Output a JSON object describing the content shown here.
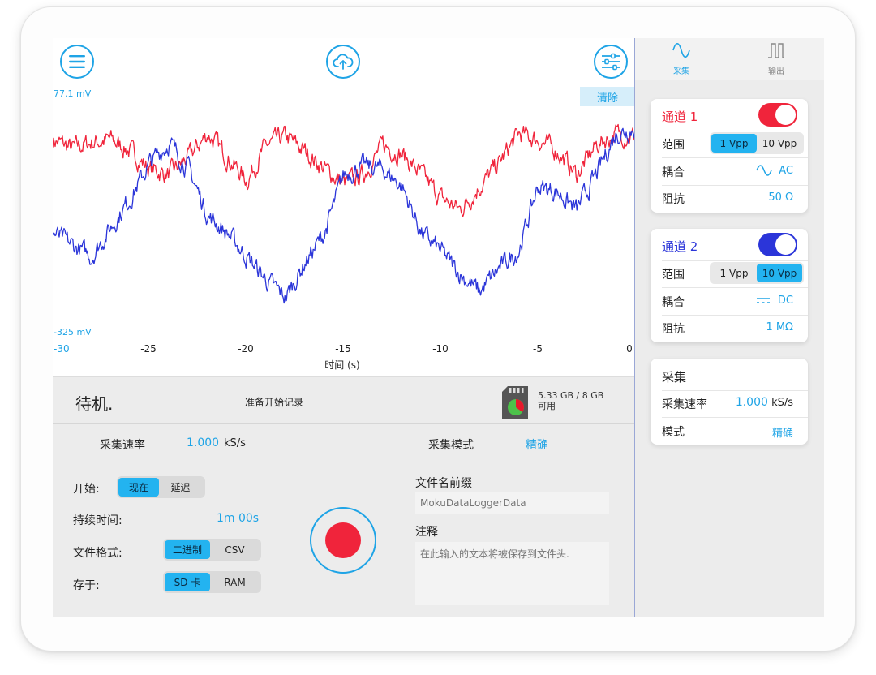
{
  "toolbar": {
    "menu_icon": "hamburger-icon",
    "upload_icon": "cloud-upload-icon",
    "settings_icon": "sliders-icon",
    "clear_label": "清除"
  },
  "plot": {
    "y_max_label": "77.1 mV",
    "y_min_label": "-325 mV",
    "x_label": "时间 (s)",
    "x_ticks": [
      "-30",
      "-25",
      "-20",
      "-15",
      "-10",
      "-5",
      "0"
    ]
  },
  "chart_data": {
    "type": "line",
    "xlabel": "时间 (s)",
    "xlim": [
      -30,
      0
    ],
    "ylim": [
      -325,
      77.1
    ],
    "y_unit": "mV",
    "grid": false,
    "series": [
      {
        "color": "#f0243b",
        "x": [
          -30,
          -29,
          -28,
          -27,
          -26,
          -25,
          -24,
          -23,
          -22,
          -21,
          -20,
          -19,
          -18,
          -17,
          -16,
          -15,
          -14,
          -13,
          -12,
          -11,
          -10,
          -9,
          -8,
          -7,
          -6,
          -5,
          -4,
          -3,
          -2,
          -1,
          0
        ],
        "y": [
          20,
          5,
          15,
          20,
          0,
          -30,
          -40,
          -10,
          30,
          -10,
          -50,
          10,
          25,
          0,
          -30,
          -55,
          -40,
          10,
          -5,
          -40,
          -80,
          -100,
          -60,
          -20,
          30,
          20,
          0,
          -40,
          10,
          30,
          25
        ]
      },
      {
        "color": "#2b35d9",
        "x": [
          -30,
          -29,
          -28,
          -27,
          -26,
          -25,
          -24,
          -23,
          -22,
          -21,
          -20,
          -19,
          -18,
          -17,
          -16,
          -15,
          -14,
          -13,
          -12,
          -11,
          -10,
          -9,
          -8,
          -7,
          -6,
          -5,
          -4,
          -3,
          -2,
          -1,
          0
        ],
        "y": [
          -140,
          -160,
          -180,
          -130,
          -80,
          -20,
          15,
          -30,
          -110,
          -140,
          -180,
          -220,
          -250,
          -190,
          -140,
          -40,
          -25,
          -30,
          -60,
          -140,
          -170,
          -210,
          -240,
          -200,
          -170,
          -60,
          -70,
          -100,
          -40,
          30,
          40
        ]
      }
    ]
  },
  "status": {
    "state": "待机.",
    "ready": "准备开始记录",
    "storage_line1": "5.33 GB / 8 GB",
    "storage_line2": "可用",
    "storage_used_fraction": 0.33
  },
  "rate_row": {
    "rate_label": "采集速率",
    "rate_value": "1.000",
    "rate_unit": "kS/s",
    "mode_label": "采集模式",
    "mode_value": "精确"
  },
  "controls": {
    "start_label": "开始:",
    "start_options": [
      "现在",
      "延迟"
    ],
    "duration_label": "持续时间:",
    "duration_value": "1m 00s",
    "format_label": "文件格式:",
    "format_options": [
      "二进制",
      "CSV"
    ],
    "save_label": "存于:",
    "save_options": [
      "SD 卡",
      "RAM"
    ],
    "prefix_label": "文件名前缀",
    "prefix_placeholder": "MokuDataLoggerData",
    "notes_label": "注释",
    "notes_placeholder": "在此输入的文本将被保存到文件头."
  },
  "side": {
    "tabs": [
      {
        "label": "采集",
        "icon": "sine-wave-icon",
        "color": "#1fa4e6"
      },
      {
        "label": "输出",
        "icon": "square-wave-icon",
        "color": "#888888"
      }
    ],
    "channel1": {
      "title": "通道 1",
      "color": "#f0243b",
      "range_label": "范围",
      "range_options": [
        "1 Vpp",
        "10 Vpp"
      ],
      "coupling_label": "耦合",
      "coupling_value": "AC",
      "impedance_label": "阻抗",
      "impedance_value": "50 Ω"
    },
    "channel2": {
      "title": "通道 2",
      "color": "#2b35d9",
      "range_label": "范围",
      "range_options": [
        "1 Vpp",
        "10 Vpp"
      ],
      "coupling_label": "耦合",
      "coupling_value": "DC",
      "impedance_label": "阻抗",
      "impedance_value": "1 MΩ"
    },
    "acq": {
      "title": "采集",
      "rate_label": "采集速率",
      "rate_value": "1.000",
      "rate_unit": "kS/s",
      "mode_label": "模式",
      "mode_value": "精确"
    }
  }
}
